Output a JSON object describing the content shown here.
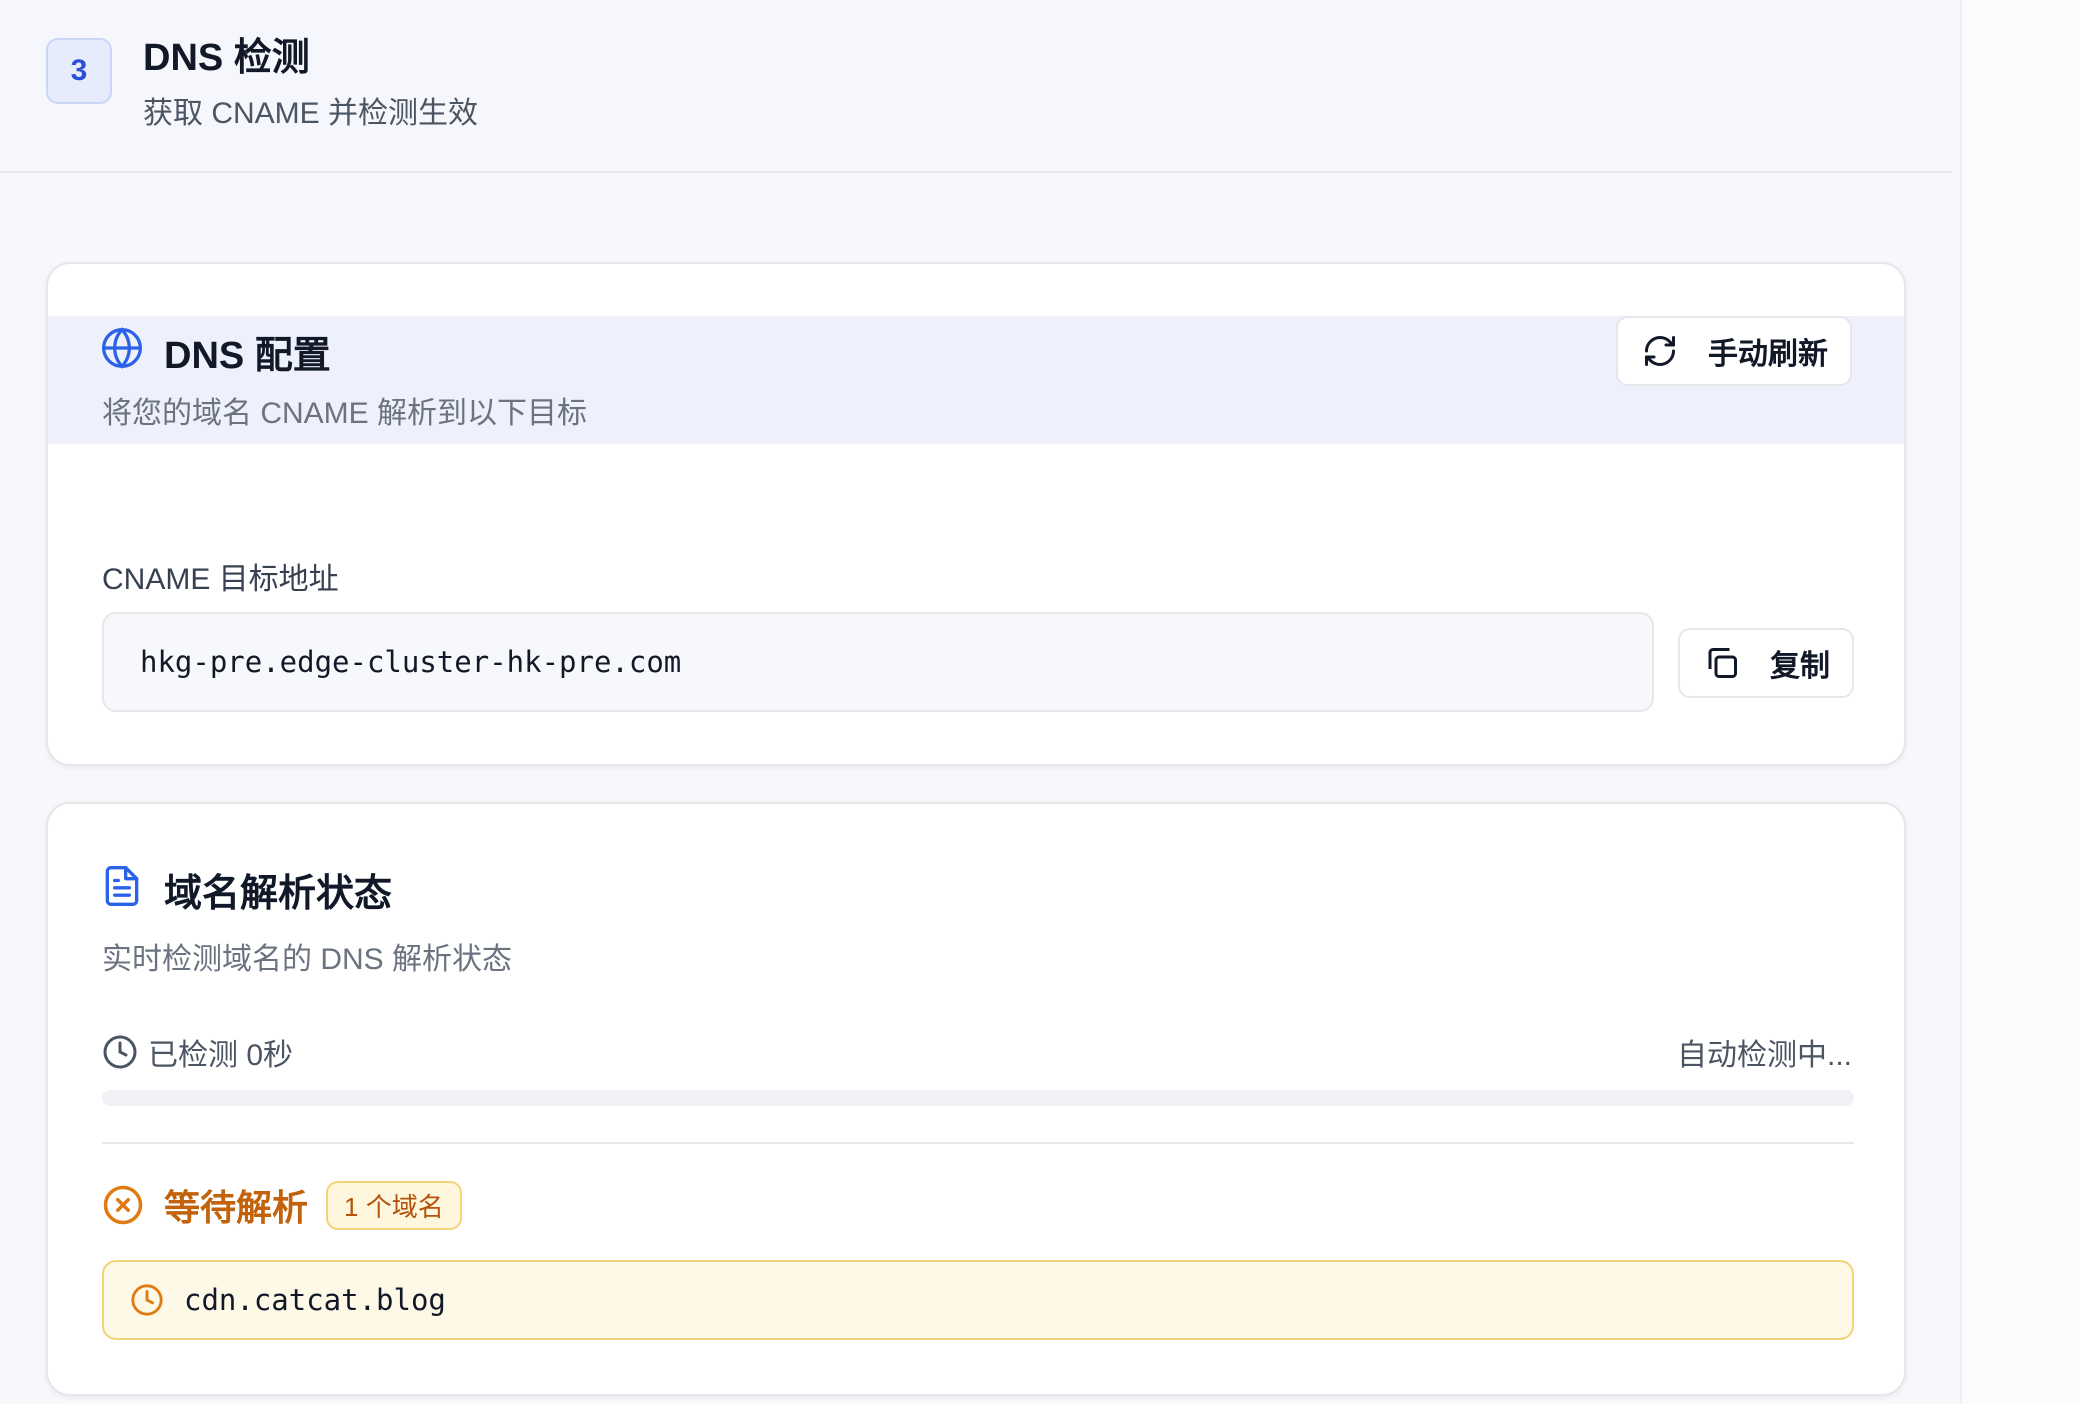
{
  "step": {
    "number": "3",
    "title": "DNS 检测",
    "subtitle": "获取 CNAME 并检测生效"
  },
  "dns_config": {
    "title": "DNS 配置",
    "subtitle": "将您的域名 CNAME 解析到以下目标",
    "refresh_label": "手动刷新",
    "field_label": "CNAME 目标地址",
    "cname_value": "hkg-pre.edge-cluster-hk-pre.com",
    "copy_label": "复制"
  },
  "resolution_status": {
    "title": "域名解析状态",
    "subtitle": "实时检测域名的 DNS 解析状态",
    "elapsed_label": "已检测 0秒",
    "auto_label": "自动检测中...",
    "progress": 0,
    "pending_label": "等待解析",
    "count_badge": "1 个域名",
    "domains": [
      "cdn.catcat.blog"
    ]
  },
  "colors": {
    "accent": "#2b50d8",
    "pending": "#c2620a",
    "pending_bg": "#fef8e6"
  },
  "icons": {
    "card1": "globe-icon",
    "refresh": "refresh-icon",
    "copy": "copy-icon",
    "card2": "document-icon",
    "elapsed": "clock-icon",
    "pending": "x-circle-icon",
    "domain": "clock-icon"
  }
}
